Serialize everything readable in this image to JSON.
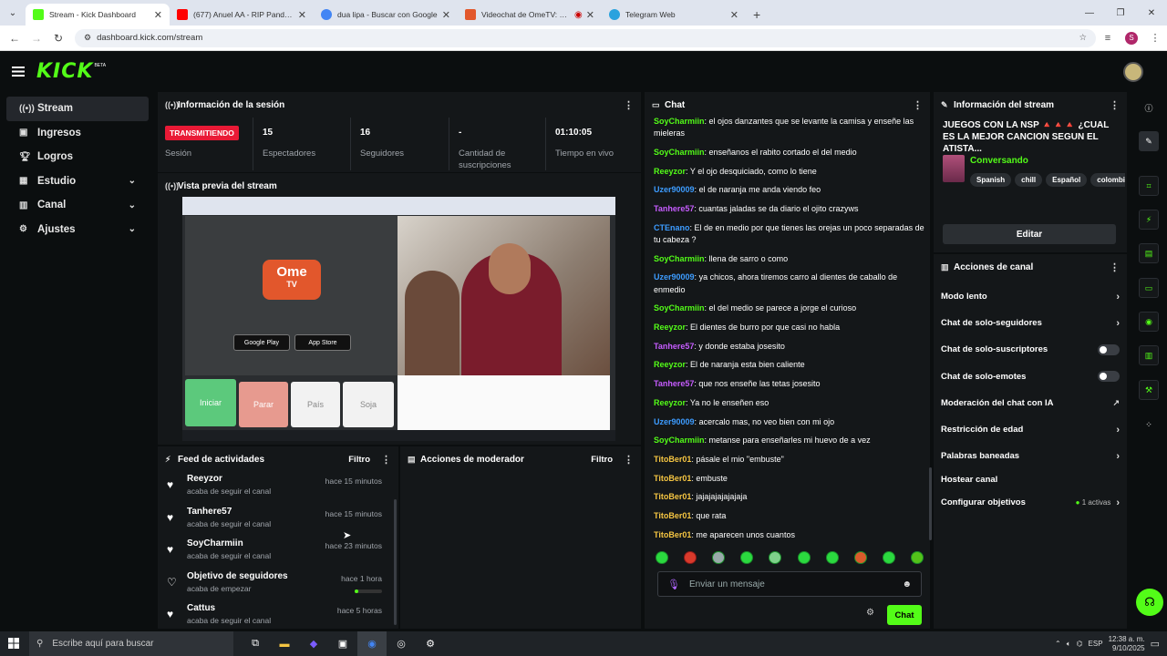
{
  "browser": {
    "tabs": [
      {
        "label": "Stream - Kick Dashboard",
        "fav_color": "#53fc18"
      },
      {
        "label": "(677) Anuel AA - RIP Panda ft. A",
        "fav_color": "#ff0000"
      },
      {
        "label": "dua lipa - Buscar con Google",
        "fav_color": "#4285f4"
      },
      {
        "label": "Videochat de OmeTV: uno",
        "fav_color": "#e2572c"
      },
      {
        "label": "Telegram Web",
        "fav_color": "#2aa2de"
      }
    ],
    "url": "dashboard.kick.com/stream",
    "profile_initial": "S"
  },
  "header": {
    "logo": "KICK",
    "beta": "BETA"
  },
  "sidebar": {
    "items": [
      {
        "label": "Stream",
        "icon": "broadcast-icon"
      },
      {
        "label": "Ingresos",
        "icon": "revenue-icon"
      },
      {
        "label": "Logros",
        "icon": "trophy-icon"
      },
      {
        "label": "Estudio",
        "icon": "studio-icon"
      },
      {
        "label": "Canal",
        "icon": "channel-icon"
      },
      {
        "label": "Ajustes",
        "icon": "gear-icon"
      }
    ]
  },
  "session": {
    "title": "Información de la sesión",
    "status": "TRANSMITIENDO",
    "status_label": "Sesión",
    "viewers": "15",
    "viewers_label": "Espectadores",
    "followers": "16",
    "followers_label": "Seguidores",
    "subs": "-",
    "subs_label": "Cantidad de suscripciones",
    "uptime": "01:10:05",
    "uptime_label": "Tiempo en vivo"
  },
  "preview": {
    "title": "Vista previa del stream",
    "ome_text": "Ome",
    "tv_text": "TV",
    "btn_start": "Iniciar",
    "btn_stop": "Parar",
    "btn_country": "País",
    "btn_gender": "Soja",
    "googleplay": "Google Play",
    "appstore": "App Store"
  },
  "activity": {
    "title": "Feed de actividades",
    "filter": "Filtro",
    "items": [
      {
        "name": "Reeyzor",
        "sub": "acaba de seguir el canal",
        "time": "hace 15 minutos"
      },
      {
        "name": "Tanhere57",
        "sub": "acaba de seguir el canal",
        "time": "hace 15 minutos"
      },
      {
        "name": "SoyCharmiin",
        "sub": "acaba de seguir el canal",
        "time": "hace 23 minutos"
      },
      {
        "name": "Objetivo de seguidores",
        "sub": "acaba de empezar",
        "time": "hace 1 hora"
      },
      {
        "name": "Cattus",
        "sub": "acaba de seguir el canal",
        "time": "hace 5 horas"
      }
    ]
  },
  "modactions": {
    "title": "Acciones de moderador",
    "filter": "Filtro"
  },
  "chat": {
    "title": "Chat",
    "placeholder": "Enviar un mensaje",
    "send": "Chat",
    "messages": [
      {
        "user": "SoyCharmiin",
        "color": "#53fc18",
        "text": "el ojos danzantes que se levante la camisa y enseñe las mieleras"
      },
      {
        "user": "SoyCharmiin",
        "color": "#53fc18",
        "text": "enseñanos el rabito cortado el del medio"
      },
      {
        "user": "Reeyzor",
        "color": "#53fc18",
        "text": "Y el ojo desquiciado, como lo tiene"
      },
      {
        "user": "Uzer90009",
        "color": "#3d9cff",
        "text": "el de naranja me anda viendo feo"
      },
      {
        "user": "Tanhere57",
        "color": "#c65cff",
        "text": "cuantas jaladas se da diario el ojito crazyws"
      },
      {
        "user": "CTEnano",
        "color": "#3d9cff",
        "text": "El de en medio por que tienes las orejas un poco separadas de tu cabeza ?"
      },
      {
        "user": "SoyCharmiin",
        "color": "#53fc18",
        "text": "llena de sarro o como"
      },
      {
        "user": "Uzer90009",
        "color": "#3d9cff",
        "text": "ya chicos, ahora tiremos carro al dientes de caballo de enmedio"
      },
      {
        "user": "SoyCharmiin",
        "color": "#53fc18",
        "text": "el del medio se parece a jorge el curioso"
      },
      {
        "user": "Reeyzor",
        "color": "#53fc18",
        "text": "El dientes de burro por que casi no habla"
      },
      {
        "user": "Tanhere57",
        "color": "#c65cff",
        "text": "y donde estaba josesito"
      },
      {
        "user": "Reeyzor",
        "color": "#53fc18",
        "text": "El de naranja esta bien caliente"
      },
      {
        "user": "Tanhere57",
        "color": "#c65cff",
        "text": "que nos enseñe las tetas josesito"
      },
      {
        "user": "Reeyzor",
        "color": "#53fc18",
        "text": "Ya no le enseñen eso"
      },
      {
        "user": "Uzer90009",
        "color": "#3d9cff",
        "text": "acercalo mas, no veo bien con mi ojo"
      },
      {
        "user": "SoyCharmiin",
        "color": "#53fc18",
        "text": "metanse para enseñarles mi huevo de a vez"
      },
      {
        "user": "TitoBer01",
        "color": "#f5c542",
        "text": "pásale el mio \"embuste\""
      },
      {
        "user": "TitoBer01",
        "color": "#f5c542",
        "text": "embuste"
      },
      {
        "user": "TitoBer01",
        "color": "#f5c542",
        "text": "jajajajajajajaja"
      },
      {
        "user": "TitoBer01",
        "color": "#f5c542",
        "text": "que rata"
      },
      {
        "user": "TitoBer01",
        "color": "#f5c542",
        "text": "me aparecen unos cuantos"
      }
    ]
  },
  "streaminfo": {
    "title": "Información del stream",
    "stream_title": "JUEGOS CON LA NSP 🔺🔺🔺 ¿CUAL ES LA MEJOR CANCION SEGUN EL ATISTA...",
    "category": "Conversando",
    "tags": [
      "Spanish",
      "chill",
      "Español",
      "colombi"
    ],
    "edit": "Editar"
  },
  "channelactions": {
    "title": "Acciones de canal",
    "items": [
      {
        "label": "Modo lento",
        "ctrl": "arrow"
      },
      {
        "label": "Chat de solo-seguidores",
        "ctrl": "arrow"
      },
      {
        "label": "Chat de solo-suscriptores",
        "ctrl": "toggle"
      },
      {
        "label": "Chat de solo-emotes",
        "ctrl": "toggle"
      },
      {
        "label": "Moderación del chat con IA",
        "ctrl": "external"
      },
      {
        "label": "Restricción de edad",
        "ctrl": "arrow"
      },
      {
        "label": "Palabras baneadas",
        "ctrl": "arrow"
      },
      {
        "label": "Hostear canal",
        "ctrl": "none"
      },
      {
        "label": "Configurar objetivos",
        "ctrl": "arrow",
        "extra": "1 activas"
      }
    ]
  },
  "taskbar": {
    "search": "Escribe aquí para buscar",
    "lang": "ESP",
    "time": "12:38 a. m.",
    "date": "9/10/2025"
  },
  "colors": {
    "accent": "#53fc18",
    "live": "#e91a36"
  }
}
